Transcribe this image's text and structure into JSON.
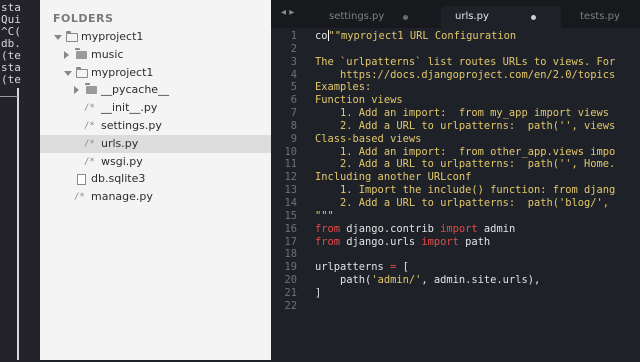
{
  "terminal": {
    "lines": [
      "sta",
      "Qui",
      "^C(",
      "db.",
      "(te",
      "sta",
      "(te"
    ]
  },
  "sidebar": {
    "title": "FOLDERS",
    "items": [
      {
        "label": "myproject1",
        "kind": "folder-open",
        "depth": 0,
        "expanded": true
      },
      {
        "label": "music",
        "kind": "folder",
        "depth": 1,
        "expanded": false
      },
      {
        "label": "myproject1",
        "kind": "folder-open",
        "depth": 1,
        "expanded": true
      },
      {
        "label": "__pycache__",
        "kind": "folder",
        "depth": 2,
        "expanded": false
      },
      {
        "label": "__init__.py",
        "kind": "file",
        "depth": 2
      },
      {
        "label": "settings.py",
        "kind": "file",
        "depth": 2
      },
      {
        "label": "urls.py",
        "kind": "file",
        "depth": 2,
        "selected": true
      },
      {
        "label": "wsgi.py",
        "kind": "file",
        "depth": 2
      },
      {
        "label": "db.sqlite3",
        "kind": "doc",
        "depth": 1
      },
      {
        "label": "manage.py",
        "kind": "file",
        "depth": 1
      }
    ]
  },
  "editor": {
    "nav": "◂ ▸",
    "tabs": [
      {
        "label": "settings.py",
        "active": false
      },
      {
        "label": "urls.py",
        "active": true
      },
      {
        "label": "tests.py",
        "active": false
      }
    ],
    "lines": [
      [
        {
          "t": "co",
          "c": "plain"
        },
        {
          "t": "|",
          "c": "cursor"
        },
        {
          "t": "\"\"myproject1 URL Configuration",
          "c": "str"
        }
      ],
      [],
      [
        {
          "t": "The `urlpatterns` list routes URLs to views. For",
          "c": "str"
        }
      ],
      [
        {
          "t": "    https://docs.djangoproject.com/en/2.0/topics",
          "c": "str"
        }
      ],
      [
        {
          "t": "Examples:",
          "c": "str"
        }
      ],
      [
        {
          "t": "Function views",
          "c": "str"
        }
      ],
      [
        {
          "t": "    1. Add an import:  from my_app import views",
          "c": "str"
        }
      ],
      [
        {
          "t": "    2. Add a URL to urlpatterns:  path('', views",
          "c": "str"
        }
      ],
      [
        {
          "t": "Class-based views",
          "c": "str"
        }
      ],
      [
        {
          "t": "    1. Add an import:  from other_app.views impo",
          "c": "str"
        }
      ],
      [
        {
          "t": "    2. Add a URL to urlpatterns:  path('', Home.",
          "c": "str"
        }
      ],
      [
        {
          "t": "Including another URLconf",
          "c": "str"
        }
      ],
      [
        {
          "t": "    1. Import the include() function: from djang",
          "c": "str"
        }
      ],
      [
        {
          "t": "    2. Add a URL to urlpatterns:  path('blog/',",
          "c": "str"
        }
      ],
      [
        {
          "t": "\"\"\"",
          "c": "str"
        }
      ],
      [
        {
          "t": "from",
          "c": "kw"
        },
        {
          "t": " django.contrib ",
          "c": "plain"
        },
        {
          "t": "import",
          "c": "kw"
        },
        {
          "t": " admin",
          "c": "plain"
        }
      ],
      [
        {
          "t": "from",
          "c": "kw"
        },
        {
          "t": " django.urls ",
          "c": "plain"
        },
        {
          "t": "import",
          "c": "kw"
        },
        {
          "t": " path",
          "c": "plain"
        }
      ],
      [],
      [
        {
          "t": "urlpatterns ",
          "c": "plain"
        },
        {
          "t": "=",
          "c": "op"
        },
        {
          "t": " [",
          "c": "plain"
        }
      ],
      [
        {
          "t": "    path(",
          "c": "plain"
        },
        {
          "t": "'admin/'",
          "c": "str"
        },
        {
          "t": ", admin.site.urls),",
          "c": "plain"
        }
      ],
      [
        {
          "t": "]",
          "c": "plain"
        }
      ],
      []
    ]
  },
  "colors": {
    "sidebar_bg": "#f4f4f4",
    "editor_bg": "#1e2228",
    "keyword": "#e34a4a",
    "string": "#e2c76a"
  }
}
